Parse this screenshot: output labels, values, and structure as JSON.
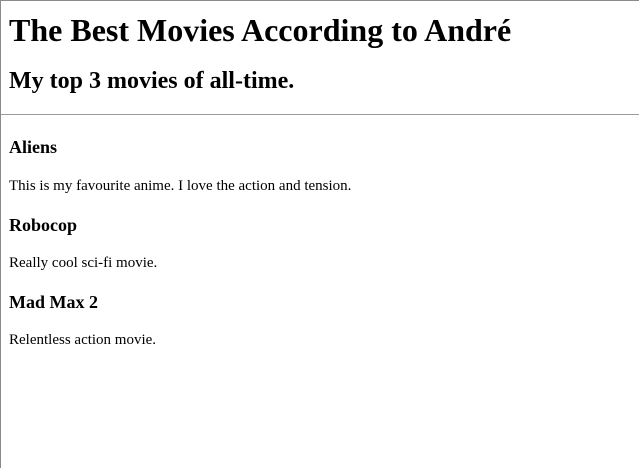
{
  "header": {
    "title": "The Best Movies According to André",
    "subtitle": "My top 3 movies of all-time."
  },
  "movies": [
    {
      "title": "Aliens",
      "description": "This is my favourite anime. I love the action and tension."
    },
    {
      "title": "Robocop",
      "description": "Really cool sci-fi movie."
    },
    {
      "title": "Mad Max 2",
      "description": "Relentless action movie."
    }
  ]
}
